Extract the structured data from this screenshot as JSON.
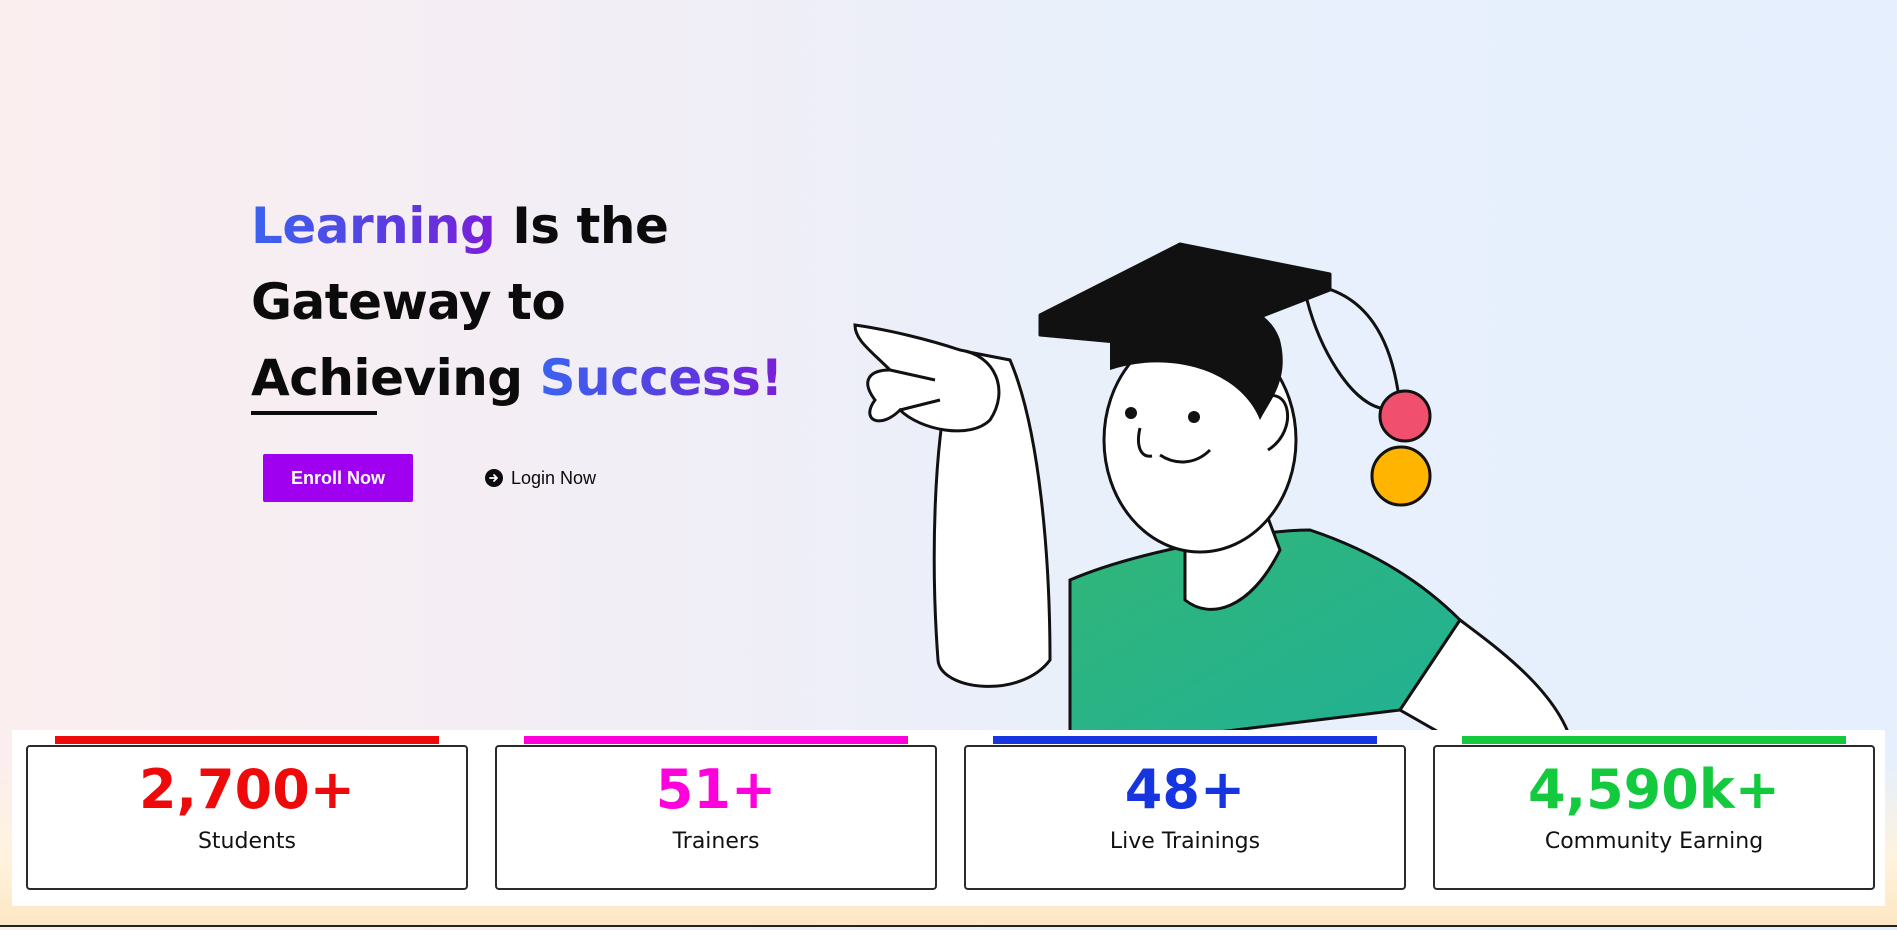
{
  "hero": {
    "headline_word1": "Learning",
    "headline_rest1": " Is the",
    "headline_line2": "Gateway to",
    "headline_line3_plain": "Achieving ",
    "headline_line3_grad": "Success!",
    "enroll_label": "Enroll Now",
    "login_label": "Login Now"
  },
  "stats": [
    {
      "value": "2,700+",
      "label": "Students",
      "color": "#ee0a0a"
    },
    {
      "value": "51+",
      "label": "Trainers",
      "color": "#ff00dd"
    },
    {
      "value": "48+",
      "label": "Live Trainings",
      "color": "#1634e0"
    },
    {
      "value": "4,590k+",
      "label": "Community Earning",
      "color": "#13c93e"
    }
  ],
  "colors": {
    "accent_purple": "#a000f0",
    "shirt_green": "#2bb47a",
    "ball_red": "#f0506e",
    "ball_yellow": "#ffb400"
  }
}
